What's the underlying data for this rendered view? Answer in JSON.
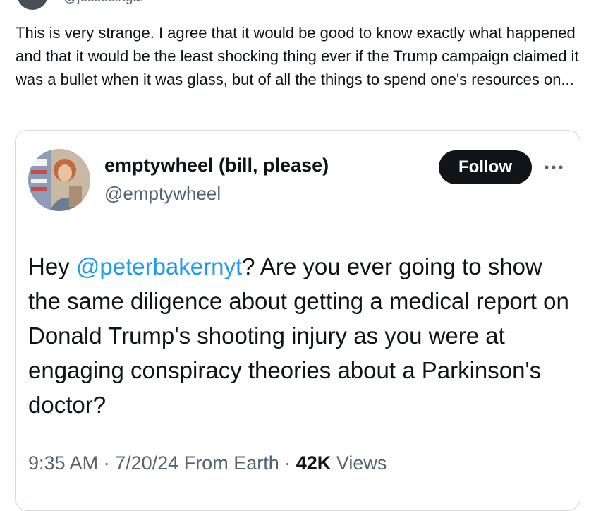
{
  "author": {
    "handle": "@jessesingal"
  },
  "post": {
    "text": "This is very strange. I agree that it would be good to know exactly what happened and that it would be the least shocking thing ever if the Trump campaign claimed it was a bullet when it was glass, but of all the things to spend one's resources on..."
  },
  "quoted": {
    "display_name": "emptywheel (bill, please)",
    "handle": "@emptywheel",
    "follow_label": "Follow",
    "more_icon": "ellipsis-icon",
    "text_before": "Hey ",
    "mention": "@peterbakernyt",
    "text_after": "? Are you ever going to show the same diligence about getting a medical report on Donald Trump's shooting injury as you were at engaging conspiracy theories about a Parkinson's doctor?",
    "time": "9:35 AM",
    "date": "7/20/24",
    "source": "From Earth",
    "views_count": "42K",
    "views_label": "Views",
    "separator": "·"
  },
  "colors": {
    "link": "#1d9bf0",
    "muted": "#536471",
    "text": "#0f1419",
    "border": "#cfd9de"
  }
}
